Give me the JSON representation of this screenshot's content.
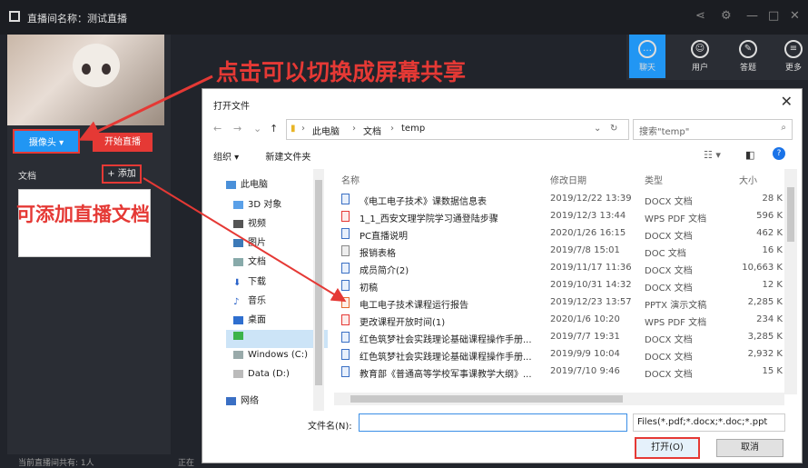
{
  "app": {
    "title": "直播间名称：测试直播",
    "camera_button": "摄像头 ▾",
    "start_live_button": "开始直播",
    "docs_label": "文档",
    "add_button": "+ 添加",
    "footer_left": "当前直播间共有: 1人",
    "footer_right": "正在",
    "right_tabs": [
      {
        "label": "聊天",
        "icon": "chat-icon"
      },
      {
        "label": "用户",
        "icon": "user-icon"
      },
      {
        "label": "答题",
        "icon": "pen-icon"
      },
      {
        "label": "更多",
        "icon": "more-icon"
      }
    ]
  },
  "annotations": {
    "switch_screen": "点击可以切换成屏幕共享",
    "add_docs": "可添加直播文档"
  },
  "dialog": {
    "title": "打开文件",
    "breadcrumb": [
      "此电脑",
      "文档",
      "temp"
    ],
    "search_placeholder": "搜索\"temp\"",
    "organize": "组织 ▾",
    "new_folder": "新建文件夹",
    "nav_items": [
      {
        "label": "此电脑",
        "icon": "computer-icon"
      },
      {
        "label": "3D 对象",
        "icon": "cube-icon"
      },
      {
        "label": "视频",
        "icon": "video-icon"
      },
      {
        "label": "图片",
        "icon": "picture-icon"
      },
      {
        "label": "文档",
        "icon": "document-icon"
      },
      {
        "label": "下载",
        "icon": "download-icon"
      },
      {
        "label": "音乐",
        "icon": "music-icon"
      },
      {
        "label": "桌面",
        "icon": "desktop-icon"
      },
      {
        "label": "",
        "icon": "app-icon"
      },
      {
        "label": "Windows (C:)",
        "icon": "drive-icon"
      },
      {
        "label": "Data (D:)",
        "icon": "drive-icon"
      },
      {
        "label": "网络",
        "icon": "network-icon"
      }
    ],
    "columns": {
      "name": "名称",
      "date": "修改日期",
      "type": "类型",
      "size": "大小"
    },
    "files": [
      {
        "name": "《电工电子技术》课数据信息表",
        "date": "2019/12/22 13:39",
        "type": "DOCX 文档",
        "size": "28 K",
        "kind": "doc"
      },
      {
        "name": "1_1_西安文理学院学习通登陆步骤",
        "date": "2019/12/3 13:44",
        "type": "WPS PDF 文档",
        "size": "596 K",
        "kind": "pdf"
      },
      {
        "name": "PC直播说明",
        "date": "2020/1/26 16:15",
        "type": "DOCX 文档",
        "size": "462 K",
        "kind": "doc"
      },
      {
        "name": "报销表格",
        "date": "2019/7/8 15:01",
        "type": "DOC 文档",
        "size": "16 K",
        "kind": "xls"
      },
      {
        "name": "成员简介(2)",
        "date": "2019/11/17 11:36",
        "type": "DOCX 文档",
        "size": "10,663 K",
        "kind": "doc"
      },
      {
        "name": "初稿",
        "date": "2019/10/31 14:32",
        "type": "DOCX 文档",
        "size": "12 K",
        "kind": "doc"
      },
      {
        "name": "电工电子技术课程运行报告",
        "date": "2019/12/23 13:57",
        "type": "PPTX 演示文稿",
        "size": "2,285 K",
        "kind": "ppt"
      },
      {
        "name": "更改课程开放时间(1)",
        "date": "2020/1/6 10:20",
        "type": "WPS PDF 文档",
        "size": "234 K",
        "kind": "pdf"
      },
      {
        "name": "红色筑梦社会实践理论基础课程操作手册...",
        "date": "2019/7/7 19:31",
        "type": "DOCX 文档",
        "size": "3,285 K",
        "kind": "doc"
      },
      {
        "name": "红色筑梦社会实践理论基础课程操作手册...",
        "date": "2019/9/9 10:04",
        "type": "DOCX 文档",
        "size": "2,932 K",
        "kind": "doc"
      },
      {
        "name": "教育部《普通高等学校军事课教学大纲》...",
        "date": "2019/7/10 9:46",
        "type": "DOCX 文档",
        "size": "15 K",
        "kind": "doc"
      }
    ],
    "filename_label": "文件名(N):",
    "filename_value": "",
    "filter_value": "Files(*.pdf;*.docx;*.doc;*.ppt",
    "open_button": "打开(O)",
    "cancel_button": "取消"
  }
}
